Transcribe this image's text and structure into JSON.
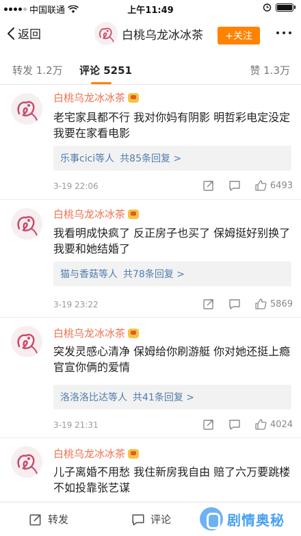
{
  "status_bar": {
    "carrier": "中国联通",
    "time": "上午11:49"
  },
  "nav": {
    "back_label": "返回",
    "title": "白桃乌龙冰冰茶",
    "follow_label": "+关注"
  },
  "tabs": {
    "repost": "转发 1.2万",
    "comments": "评论 5251",
    "likes": "赞 1.3万"
  },
  "comments": [
    {
      "name": "白桃乌龙冰冰茶",
      "text": "老宅家具都不行 我对你妈有阴影 明哲彩电定没定 我要在家看电影",
      "reply_users": "乐事cici等人",
      "reply_count": "共85条回复 >",
      "time": "3-19 22:06",
      "likes": "6493"
    },
    {
      "name": "白桃乌龙冰冰茶",
      "text": "我看明成快疯了 反正房子也买了 保姆挺好别换了 我要和她结婚了",
      "reply_users": "猫与香菇等人",
      "reply_count": "共78条回复 >",
      "time": "3-19 23:22",
      "likes": "5869"
    },
    {
      "name": "白桃乌龙冰冰茶",
      "text": "突发灵感心清净 保姆给你刷游艇 你对她还挺上瘾 官宣你俩的爱情",
      "reply_users": "洛洛洛比达等人",
      "reply_count": "共41条回复 >",
      "time": "3-19 21:31",
      "likes": "4024"
    },
    {
      "name": "白桃乌龙冰冰茶",
      "text": "儿子离婚不用愁 我住新房我自由 赔了六万要跳楼 不如投靠张艺谋"
    }
  ],
  "bottom_bar": {
    "repost_label": "转发",
    "comment_label": "评论"
  },
  "watermark": {
    "text": "剧情奥秘"
  },
  "colors": {
    "accent": "#ff8200",
    "username": "#eb7350",
    "link": "#507daf"
  }
}
